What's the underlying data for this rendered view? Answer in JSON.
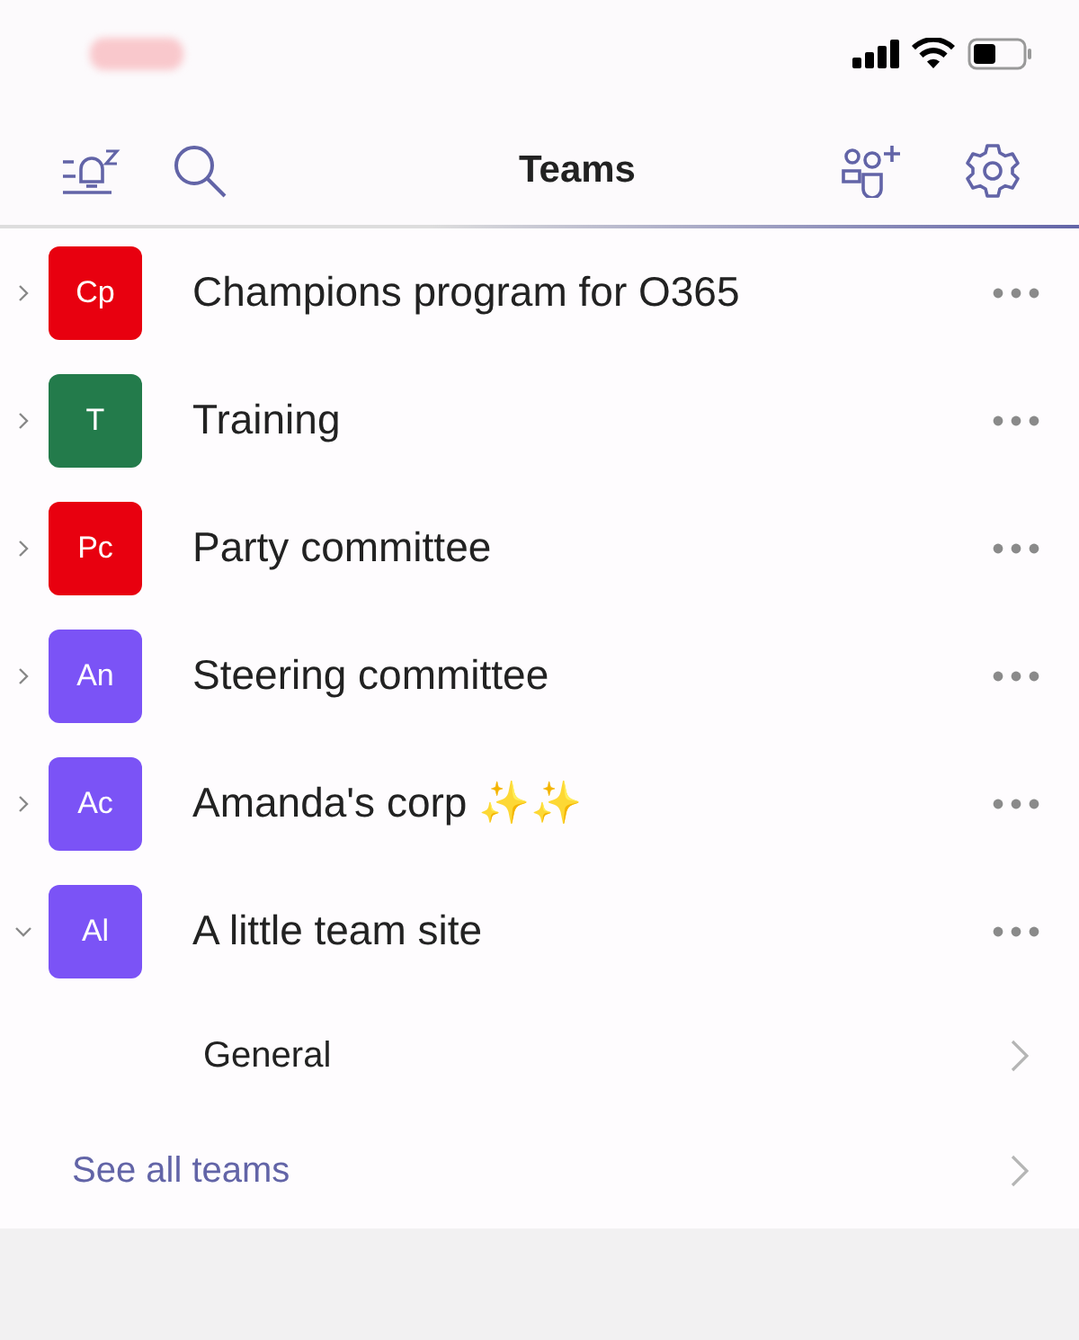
{
  "header": {
    "title": "Teams"
  },
  "teams": [
    {
      "initials": "Cp",
      "name": "Champions program for O365",
      "color": "#e8000f",
      "expanded": false
    },
    {
      "initials": "T",
      "name": "Training",
      "color": "#237b4b",
      "expanded": false
    },
    {
      "initials": "Pc",
      "name": "Party committee",
      "color": "#e8000f",
      "expanded": false
    },
    {
      "initials": "An",
      "name": "Steering committee",
      "color": "#7b53f6",
      "expanded": false
    },
    {
      "initials": "Ac",
      "name": "Amanda's corp ✨✨",
      "color": "#7b53f6",
      "expanded": false
    },
    {
      "initials": "Al",
      "name": "A little team site",
      "color": "#7b53f6",
      "expanded": true,
      "children": [
        {
          "name": "General"
        }
      ]
    }
  ],
  "see_all": {
    "label": "See all teams"
  }
}
